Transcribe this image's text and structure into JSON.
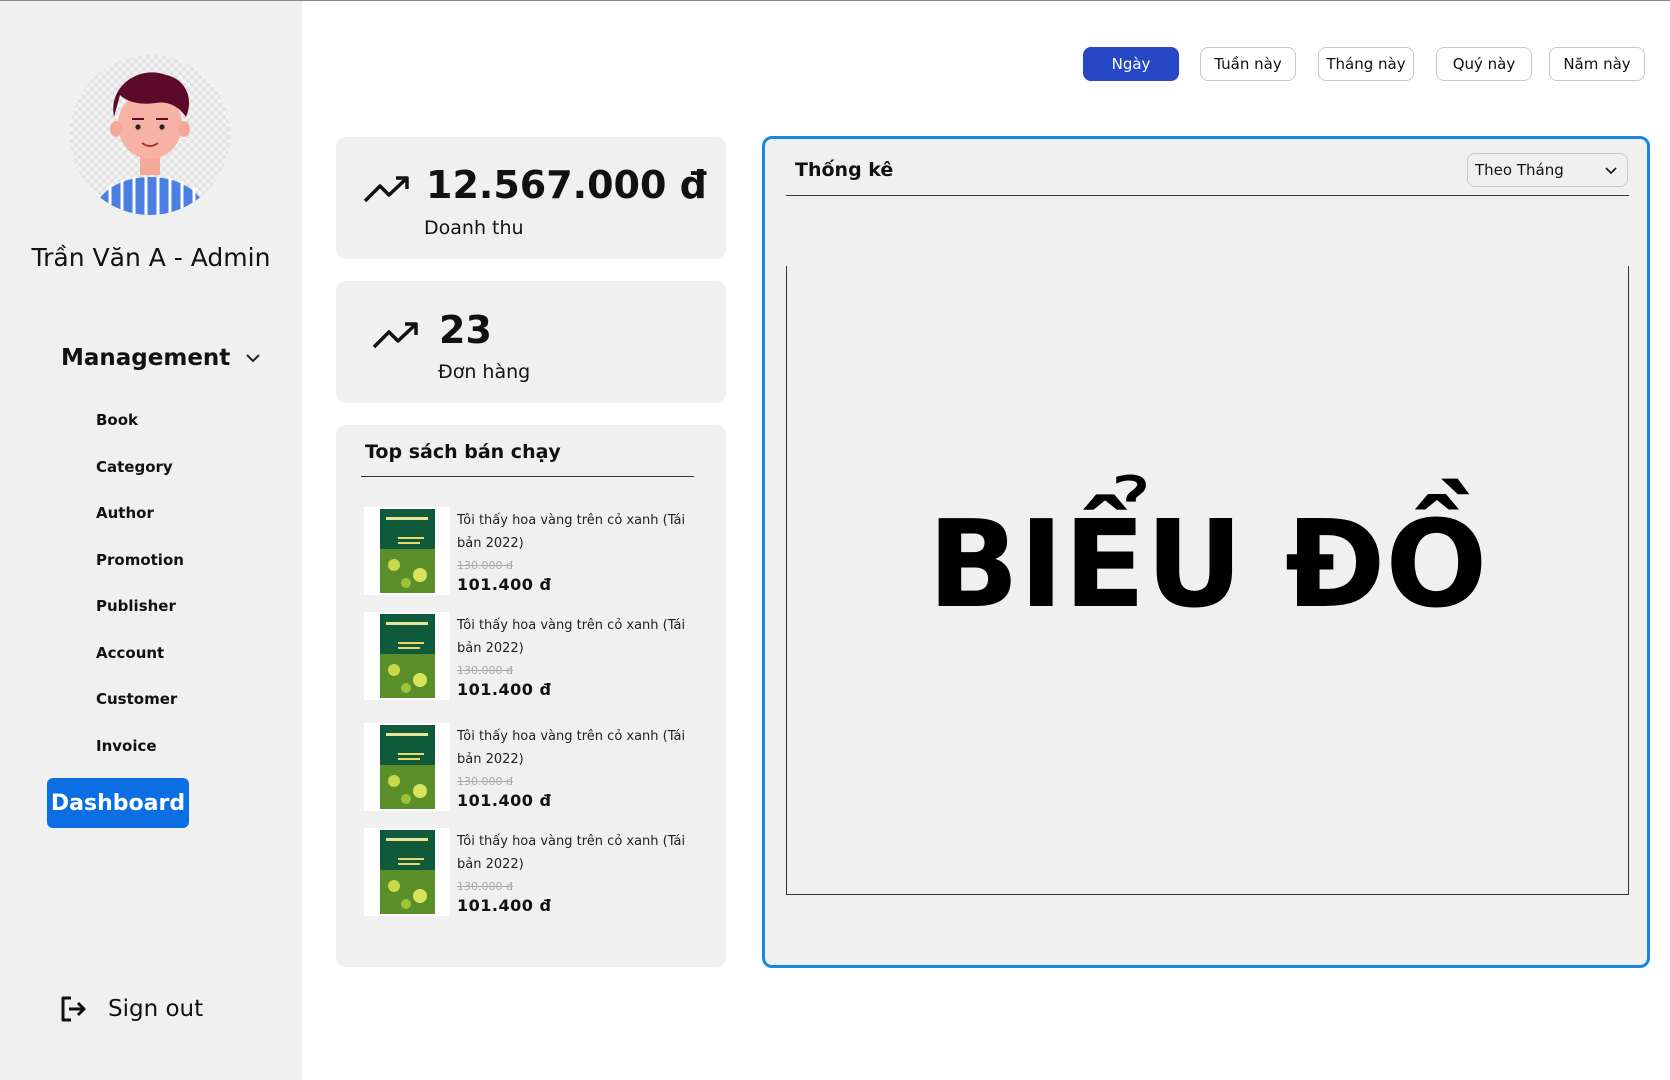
{
  "sidebar": {
    "user_name": "Trần Văn A - Admin",
    "section_label": "Management",
    "items": [
      {
        "label": "Book"
      },
      {
        "label": "Category"
      },
      {
        "label": "Author"
      },
      {
        "label": "Promotion"
      },
      {
        "label": "Publisher"
      },
      {
        "label": "Account"
      },
      {
        "label": "Customer"
      },
      {
        "label": "Invoice"
      }
    ],
    "active_label": "Dashboard",
    "signout_label": "Sign out"
  },
  "periods": {
    "active": "Ngày",
    "items": [
      "Ngày",
      "Tuần này",
      "Tháng này",
      "Quý này",
      "Năm này"
    ]
  },
  "stats": {
    "revenue": {
      "value": "12.567.000 đ",
      "label": "Doanh thu"
    },
    "orders": {
      "value": "23",
      "label": "Đơn hàng"
    }
  },
  "top_books": {
    "title": "Top sách bán chạy",
    "items": [
      {
        "name": "Tôi thấy hoa vàng trên cỏ xanh (Tái bản 2022)",
        "old_price": "130.000 đ",
        "price": "101.400 đ"
      },
      {
        "name": "Tôi thấy hoa vàng trên cỏ xanh (Tái bản 2022)",
        "old_price": "130.000 đ",
        "price": "101.400 đ"
      },
      {
        "name": "Tôi thấy hoa vàng trên cỏ xanh (Tái bản 2022)",
        "old_price": "130.000 đ",
        "price": "101.400 đ"
      },
      {
        "name": "Tôi thấy hoa vàng trên cỏ xanh (Tái bản 2022)",
        "old_price": "130.000 đ",
        "price": "101.400 đ"
      }
    ]
  },
  "stats_panel": {
    "title": "Thống kê",
    "select_value": "Theo Tháng",
    "chart_placeholder": "BIỂU ĐỒ"
  },
  "colors": {
    "accent": "#0b6fe3",
    "active_period": "#2648c6",
    "panel_border": "#1a86e0",
    "card_bg": "#f0f0f0"
  }
}
